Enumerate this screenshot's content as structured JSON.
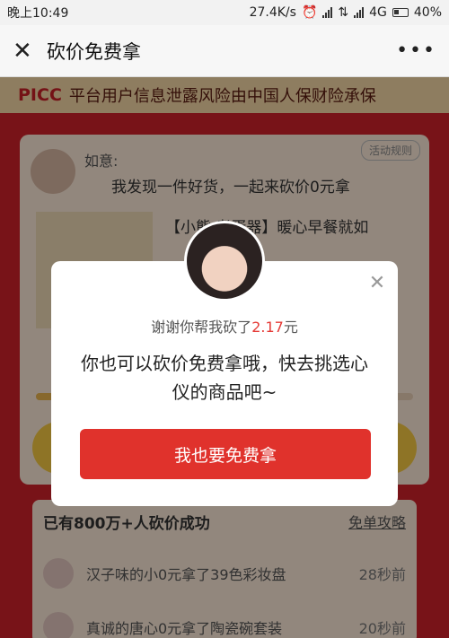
{
  "status": {
    "time": "晚上10:49",
    "speed": "27.4K/s",
    "network": "4G",
    "battery": "40%"
  },
  "nav": {
    "title": "砍价免费拿"
  },
  "banner": {
    "logo": "PICC",
    "text": "平台用户信息泄露风险由中国人保财险承保"
  },
  "card": {
    "name": "如意:",
    "rules": "活动规则",
    "message": "我发现一件好货，一起来砍价0元拿",
    "product_title": "【小熊 煮蛋器】暖心早餐就如"
  },
  "list": {
    "heading": "已有800万+人砍价成功",
    "link": "免单攻略",
    "rows": [
      {
        "text": "汉子味的小0元拿了39色彩妆盘",
        "time": "28秒前"
      },
      {
        "text": "真诚的唐心0元拿了陶瓷碗套装",
        "time": "20秒前"
      }
    ]
  },
  "modal": {
    "sub_prefix": "谢谢你帮我砍了",
    "amount": "2.17",
    "sub_suffix": "元",
    "main": "你也可以砍价免费拿哦，快去挑选心仪的商品吧~",
    "button": "我也要免费拿"
  }
}
